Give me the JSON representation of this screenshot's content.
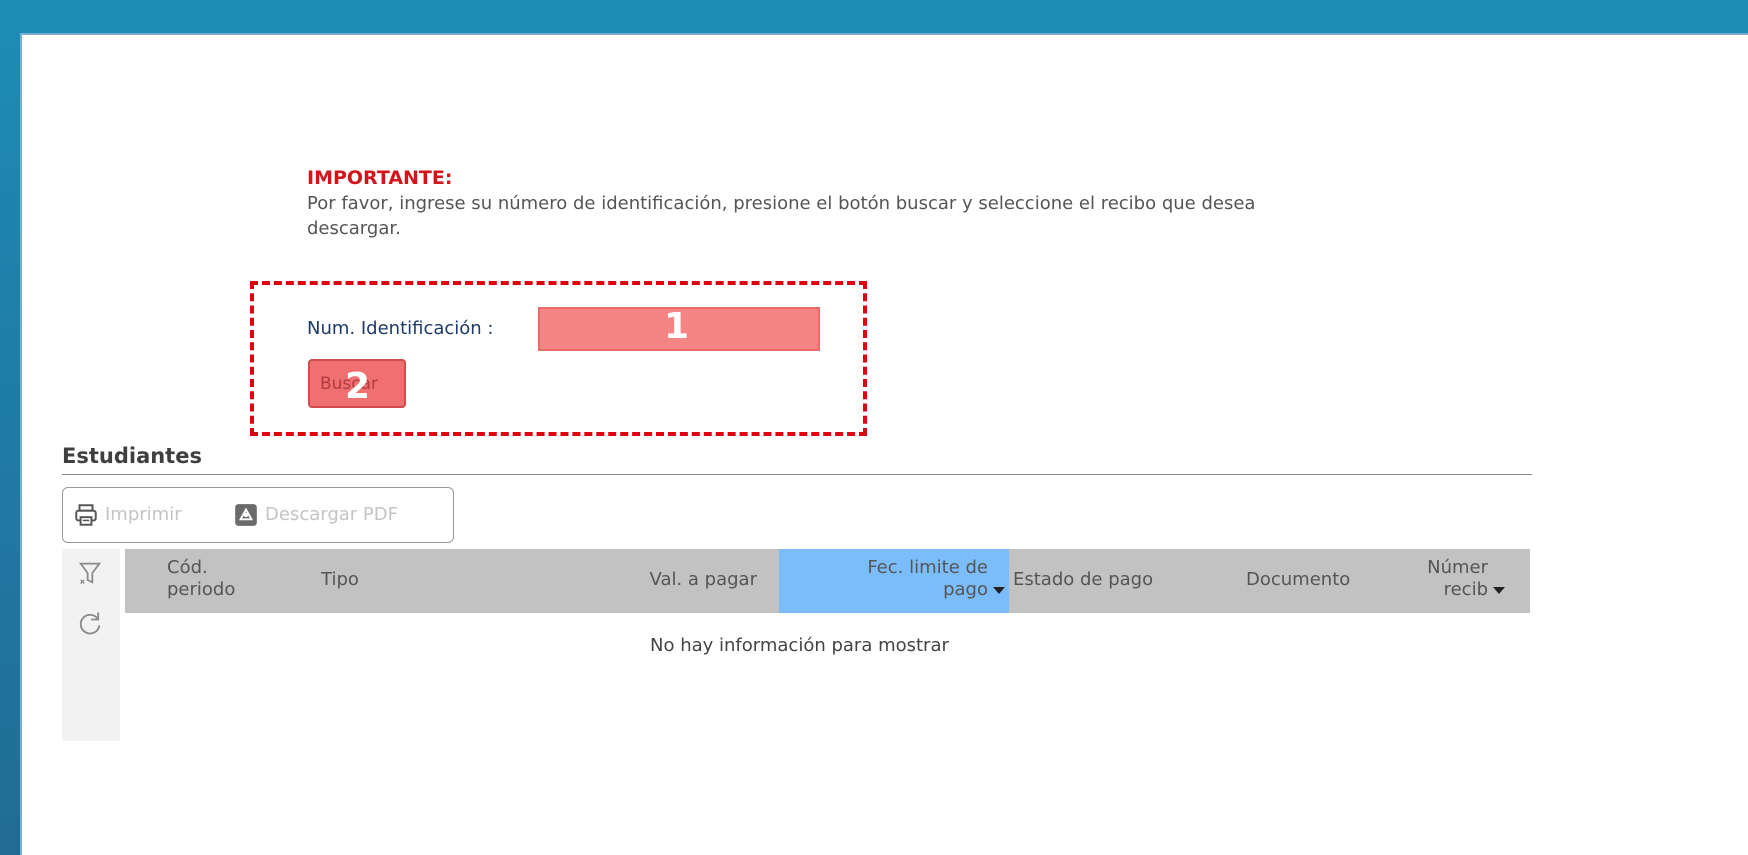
{
  "notice": {
    "title": "IMPORTANTE:",
    "text": "Por favor, ingrese su número de identificación, presione el botón buscar y seleccione el recibo que desea descargar."
  },
  "form": {
    "id_label": "Num. Identificación :",
    "id_value": "",
    "search_label": "Buscar"
  },
  "annotations": {
    "badge_1": "1",
    "badge_2": "2"
  },
  "section": {
    "title": "Estudiantes"
  },
  "toolbar": {
    "print_label": "Imprimir",
    "pdf_label": "Descargar PDF"
  },
  "grid": {
    "columns": [
      "Cód. periodo",
      "Tipo",
      "Val. a pagar",
      "Fec. limite de pago",
      "Estado de pago",
      "Documento",
      "Númer recib"
    ],
    "empty_message": "No hay información para mostrar"
  },
  "colors": {
    "accent_red": "#d3141b",
    "highlight_border": "#e00010",
    "sorted_column": "#7bbdfb",
    "header_background": "#c2c2c2"
  },
  "icons": {
    "print": "printer-icon",
    "pdf": "pdf-download-icon",
    "filter": "filter-clear-icon",
    "refresh": "refresh-icon",
    "sort": "sort-desc-icon"
  }
}
